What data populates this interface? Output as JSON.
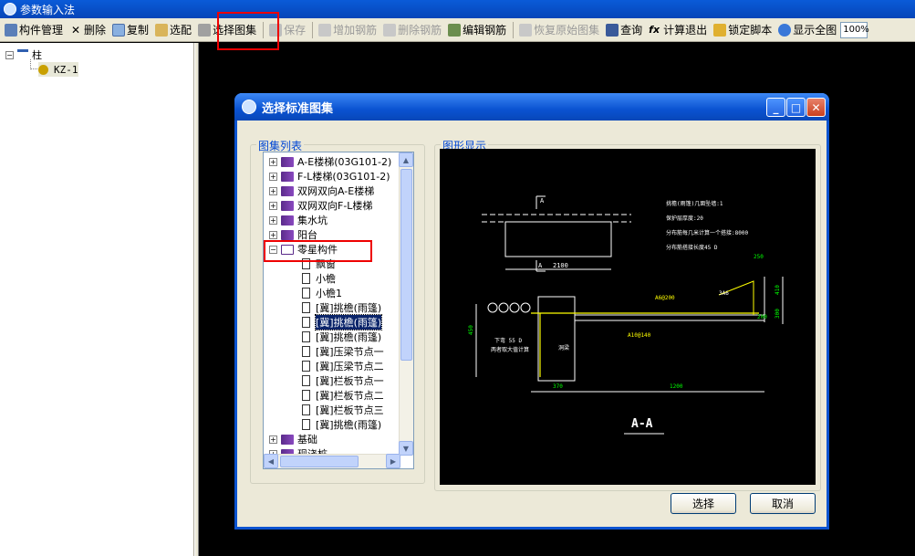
{
  "window": {
    "title": "参数输入法"
  },
  "toolbar": {
    "items": [
      {
        "label": "构件管理",
        "icon": "component-manage-icon",
        "enabled": true
      },
      {
        "label": "删除",
        "icon": "delete-x-icon",
        "enabled": true
      },
      {
        "label": "复制",
        "icon": "copy-icon",
        "enabled": true
      },
      {
        "label": "选配",
        "icon": "match-icon",
        "enabled": true
      },
      {
        "label": "选择图集",
        "icon": "select-atlas-icon",
        "enabled": true
      },
      {
        "label": "保存",
        "icon": "save-icon",
        "enabled": false
      },
      {
        "label": "增加钢筋",
        "icon": "add-rebar-icon",
        "enabled": false
      },
      {
        "label": "删除钢筋",
        "icon": "delete-rebar-icon",
        "enabled": false
      },
      {
        "label": "编辑钢筋",
        "icon": "edit-rebar-icon",
        "enabled": true
      },
      {
        "label": "恢复原始图集",
        "icon": "restore-atlas-icon",
        "enabled": false
      },
      {
        "label": "查询",
        "icon": "binoculars-icon",
        "enabled": true
      },
      {
        "label": "计算退出",
        "icon": "fx-icon",
        "enabled": true
      },
      {
        "label": "锁定脚本",
        "icon": "lock-icon",
        "enabled": true
      },
      {
        "label": "显示全图",
        "icon": "zoom-fit-icon",
        "enabled": true
      }
    ],
    "zoom": "100%"
  },
  "left_tree": {
    "root": {
      "label": "柱",
      "expander": "−"
    },
    "child": {
      "label": "KZ-1"
    }
  },
  "dialog": {
    "title": "选择标准图集",
    "list_group_label": "图集列表",
    "preview_group_label": "图形显示",
    "list_items": [
      {
        "label": "A-E楼梯(03G101-2)",
        "type": "book",
        "expander": "+"
      },
      {
        "label": "F-L楼梯(03G101-2)",
        "type": "book",
        "expander": "+"
      },
      {
        "label": "双网双向A-E楼梯",
        "type": "book",
        "expander": "+"
      },
      {
        "label": "双网双向F-L楼梯",
        "type": "book",
        "expander": "+"
      },
      {
        "label": "集水坑",
        "type": "book",
        "expander": "+"
      },
      {
        "label": "阳台",
        "type": "book",
        "expander": "+"
      },
      {
        "label": "零星构件",
        "type": "open-book",
        "expander": "−"
      },
      {
        "label": "飘窗",
        "type": "doc"
      },
      {
        "label": "小檐",
        "type": "doc"
      },
      {
        "label": "小檐1",
        "type": "doc"
      },
      {
        "label": "[冀]挑檐(雨篷)",
        "type": "doc"
      },
      {
        "label": "[冀]挑檐(雨篷)",
        "type": "doc",
        "selected": true
      },
      {
        "label": "[冀]挑檐(雨篷)",
        "type": "doc"
      },
      {
        "label": "[冀]压梁节点一",
        "type": "doc"
      },
      {
        "label": "[冀]压梁节点二",
        "type": "doc"
      },
      {
        "label": "[冀]栏板节点一",
        "type": "doc"
      },
      {
        "label": "[冀]栏板节点二",
        "type": "doc"
      },
      {
        "label": "[冀]栏板节点三",
        "type": "doc"
      },
      {
        "label": "[冀]挑檐(雨篷)",
        "type": "doc"
      },
      {
        "label": "基础",
        "type": "book",
        "expander": "+"
      },
      {
        "label": "现浇桩",
        "type": "book",
        "expander": "+"
      }
    ],
    "drawing": {
      "notes": [
        "挑檐(雨篷)几面坠墙:1",
        "保护层厚度:20",
        "分布筋每几米计算一个搭接:8000",
        "分布筋搭接长度45 D"
      ],
      "section_label": "A-A",
      "dims": [
        "2100",
        "370",
        "1200",
        "450",
        "410",
        "250",
        "300",
        "200"
      ],
      "rebar_labels": [
        "A6@200",
        "A10@140",
        "3A6"
      ],
      "cut_marks": [
        "A",
        "A"
      ],
      "beam_labels": [
        "下弯 55 D",
        "两者取大值计算",
        "洞梁"
      ]
    },
    "buttons": {
      "ok": "选择",
      "cancel": "取消"
    }
  }
}
